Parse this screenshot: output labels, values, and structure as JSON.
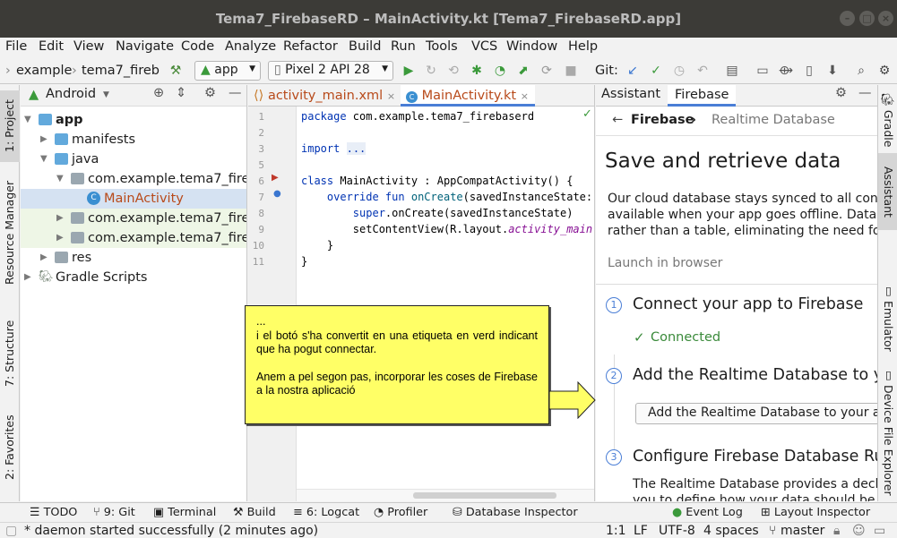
{
  "window": {
    "title": "Tema7_FirebaseRD – MainActivity.kt [Tema7_FirebaseRD.app]"
  },
  "menu": [
    "File",
    "Edit",
    "View",
    "Navigate",
    "Code",
    "Analyze",
    "Refactor",
    "Build",
    "Run",
    "Tools",
    "VCS",
    "Window",
    "Help"
  ],
  "toolbar": {
    "breadcrumb_1": "example",
    "breadcrumb_2": "tema7_fireb",
    "run_config": "app",
    "device": "Pixel 2 API 28",
    "git_label": "Git:"
  },
  "left_strip": {
    "project": "1: Project",
    "resource_manager": "Resource Manager",
    "structure": "7: Structure",
    "favorites": "2: Favorites"
  },
  "project": {
    "view_mode": "Android",
    "tree": [
      {
        "label": "app"
      },
      {
        "label": "manifests"
      },
      {
        "label": "java"
      },
      {
        "label": "com.example.tema7_fireb"
      },
      {
        "label": "MainActivity"
      },
      {
        "label": "com.example.tema7_fireb"
      },
      {
        "label": "com.example.tema7_fireb"
      },
      {
        "label": "res"
      },
      {
        "label": "Gradle Scripts"
      }
    ]
  },
  "editor": {
    "tabs": [
      {
        "label": "activity_main.xml"
      },
      {
        "label": "MainActivity.kt"
      }
    ],
    "line_numbers": [
      "1",
      "2",
      "3",
      "5",
      "6",
      "7",
      "8",
      "9",
      "10",
      "11"
    ],
    "code": {
      "l1_kw": "package",
      "l1_rest": " com.example.tema7_firebaserd",
      "l3_kw": "import",
      "l3_fold": "...",
      "l6_kw": "class",
      "l6_rest": " MainActivity : AppCompatActivity() {",
      "l7_kw": "override fun",
      "l7_fn": "onCreate",
      "l7_rest": "(savedInstanceState: B",
      "l8_kw": "super",
      "l8_rest": ".onCreate(savedInstanceState)",
      "l9_a": "setContentView(R.layout.",
      "l9_it": "activity_main",
      "l9_b": ")",
      "l10": "}",
      "l11": "}"
    }
  },
  "callout": {
    "line1": "...",
    "line2": "i el botó s'ha convertit en una etiqueta en verd indicant que ha pogut connectar.",
    "line3": "Anem a pel segon pas, incorporar les coses de Firebase a la nostra aplicació"
  },
  "assistant": {
    "tabs": [
      "Assistant",
      "Firebase"
    ],
    "nav_back": "Firebase",
    "nav_current": "Realtime Database",
    "heading": "Save and retrieve data",
    "body_1": "Our cloud database stays synced to all conne",
    "body_2": "available when your app goes offline. Data is",
    "body_3": "rather than a table, eliminating the need for",
    "launch": "Launch in browser",
    "steps": [
      {
        "num": "1",
        "title": "Connect your app to Firebase"
      },
      {
        "num": "2",
        "title": "Add the Realtime Database to you"
      },
      {
        "num": "3",
        "title": "Configure Firebase Database Rule"
      }
    ],
    "connected": "Connected",
    "add_button": "Add the Realtime Database to your ap",
    "step3_text_1": "The Realtime Database provides a declar",
    "step3_text_2": "you to define how your data should be st"
  },
  "right_strip": {
    "gradle": "Gradle",
    "assistant": "Assistant",
    "emulator": "Emulator",
    "device_explorer": "Device File Explorer"
  },
  "bottom_tabs": [
    "TODO",
    "9: Git",
    "Terminal",
    "Build",
    "6: Logcat",
    "Profiler",
    "Database Inspector",
    "Event Log",
    "Layout Inspector"
  ],
  "status": {
    "message": "* daemon started successfully (2 minutes ago)",
    "position": "1:1",
    "line_sep": "LF",
    "encoding": "UTF-8",
    "indent": "4 spaces",
    "branch": "master"
  },
  "colors": {
    "accent": "#4a7ed6",
    "connected": "#3a8a3a",
    "callout": "#ffff66",
    "selection": "#d5e2f2"
  }
}
